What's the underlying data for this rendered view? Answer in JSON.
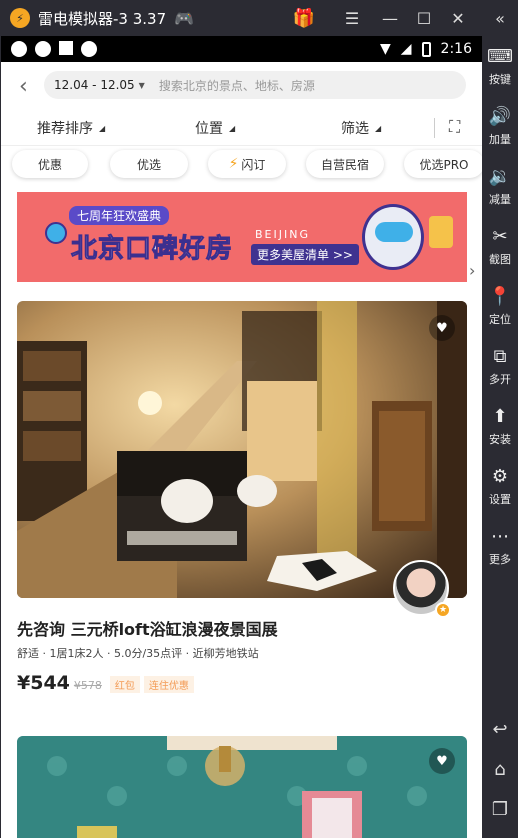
{
  "emulator": {
    "title": "雷电模拟器-3 3.37",
    "logo_text": "⚡",
    "sidebar_top": "«",
    "sidebar": [
      {
        "label": "按键",
        "icon": "keyboard-icon"
      },
      {
        "label": "加量",
        "icon": "volume-up-icon"
      },
      {
        "label": "减量",
        "icon": "volume-down-icon"
      },
      {
        "label": "截图",
        "icon": "scissors-icon"
      },
      {
        "label": "定位",
        "icon": "location-icon"
      },
      {
        "label": "多开",
        "icon": "multi-instance-icon"
      },
      {
        "label": "安装",
        "icon": "apk-install-icon"
      },
      {
        "label": "设置",
        "icon": "gear-icon"
      },
      {
        "label": "更多",
        "icon": "more-icon"
      }
    ]
  },
  "status": {
    "time": "2:16"
  },
  "search": {
    "dates": "12.04 - 12.05",
    "placeholder": "搜索北京的景点、地标、房源"
  },
  "filters": {
    "sort": "推荐排序",
    "location": "位置",
    "filter": "筛选"
  },
  "chips": [
    "优惠",
    "优选",
    "闪订",
    "自营民宿",
    "优选PRO"
  ],
  "banner": {
    "subtitle": "七周年狂欢盛典",
    "title": "北京口碑好房",
    "city": "BEIJING",
    "button": "更多美屋清单 >>"
  },
  "listing": {
    "title": "先咨询 三元桥loft浴缸浪漫夜景国展",
    "meta": "舒适 · 1居1床2人 · 5.0分/35点评 · 近柳芳地铁站",
    "price": "¥544",
    "old_price": "¥578",
    "tags": [
      "红包",
      "连住优惠"
    ]
  }
}
